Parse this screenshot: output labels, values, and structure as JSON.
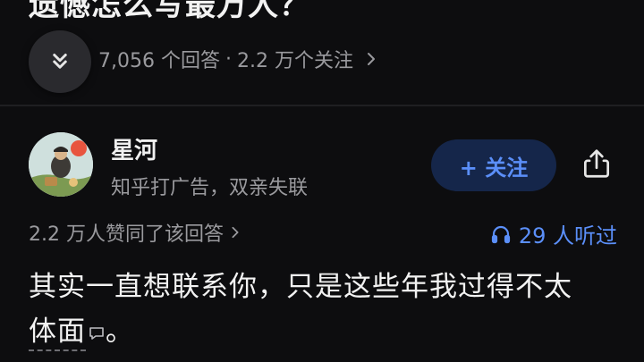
{
  "question": {
    "title": "遗憾怎么写最万人？",
    "answers_count": "7,056 个回答",
    "separator": "·",
    "followers_count": "2.2 万个关注"
  },
  "author": {
    "name": "星河",
    "bio": "知乎打广告，双亲失联",
    "follow_label": "+ 关注"
  },
  "stats": {
    "upvotes": "2.2 万人赞同了该回答",
    "listens": "29 人听过"
  },
  "answer": {
    "line1": "其实一直想联系你，只是这些年我过得不太",
    "line2_underlined": "体面",
    "line2_end": "。"
  },
  "colors": {
    "background": "#0d0d0f",
    "accent_blue": "#5b8ff9",
    "follow_bg": "#15264a",
    "muted_text": "#9a9a9e"
  },
  "icons": [
    "chevron-down-icon",
    "chevron-right-icon",
    "share-icon",
    "headphones-icon",
    "comment-icon"
  ]
}
